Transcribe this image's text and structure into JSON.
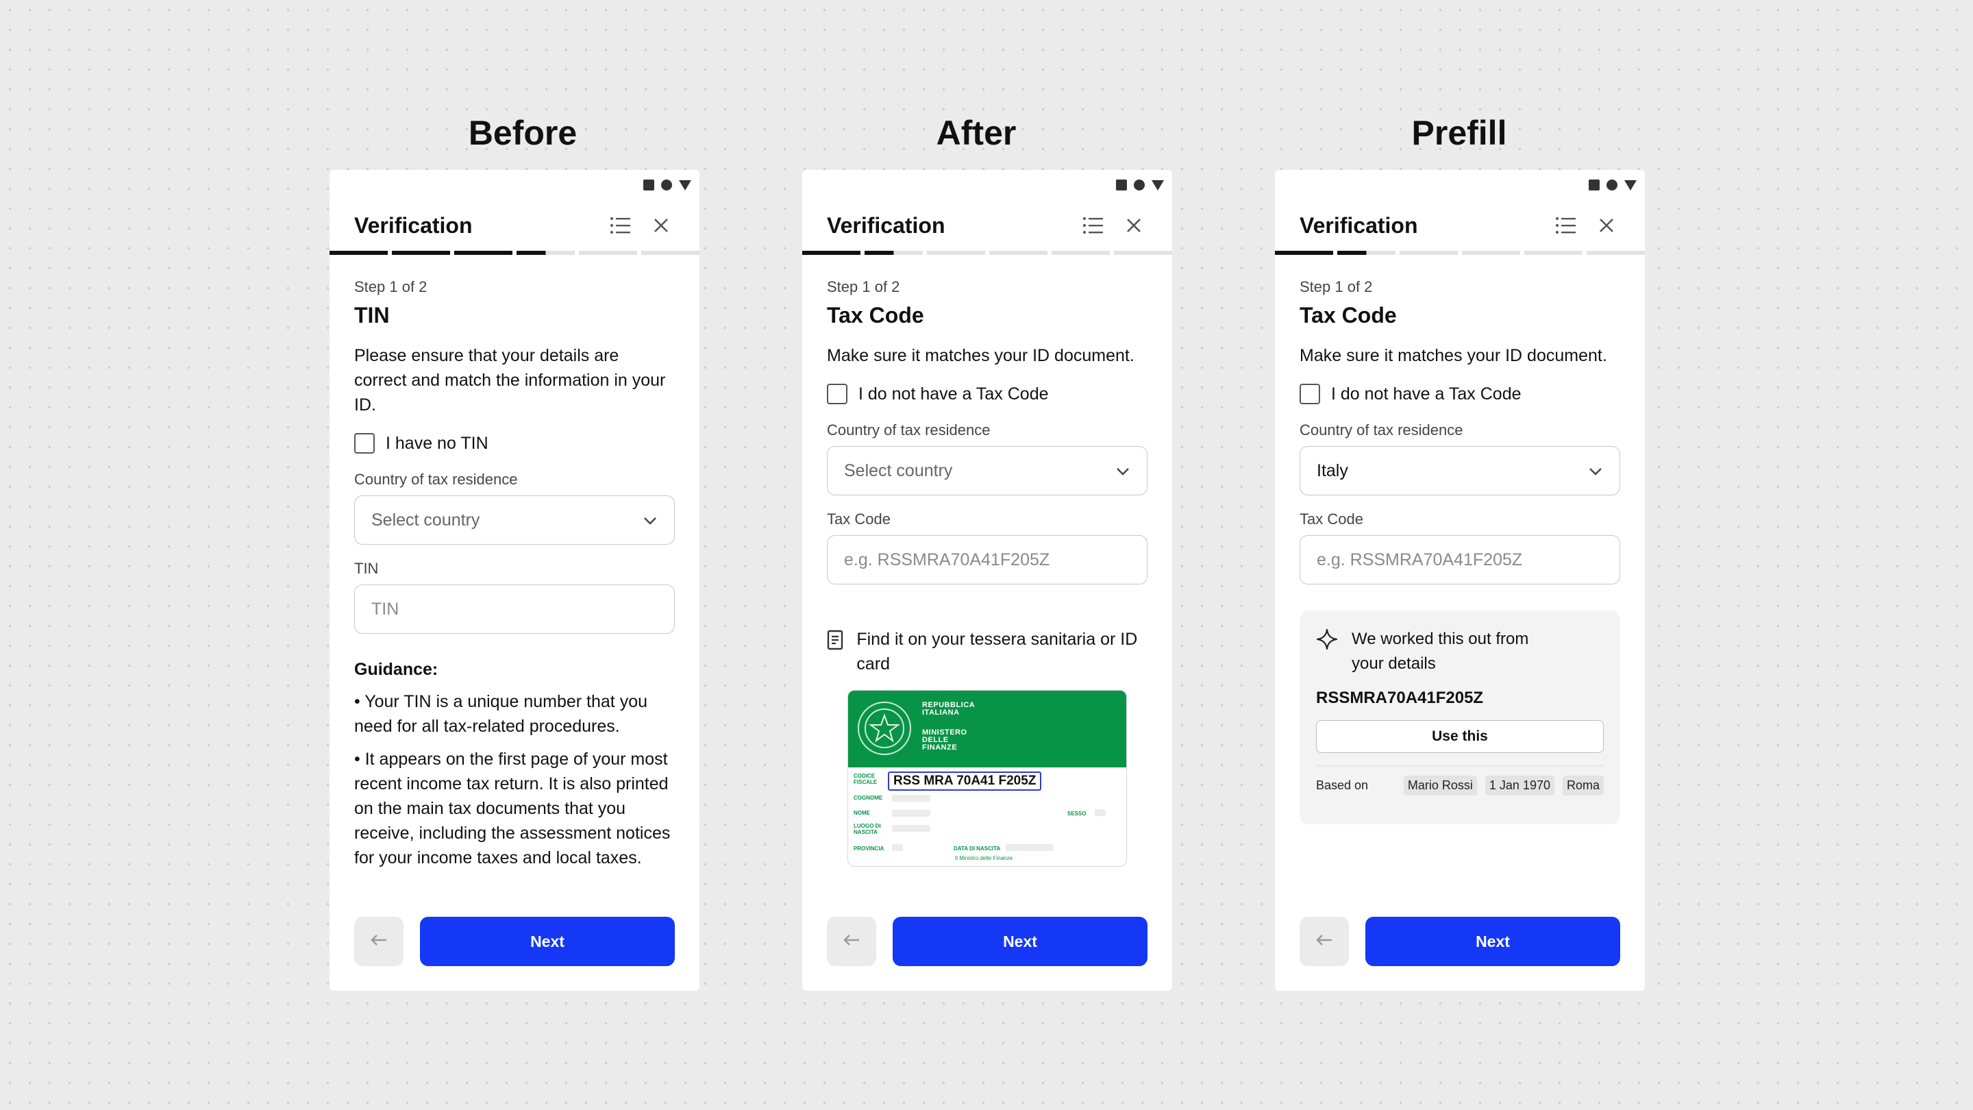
{
  "columns": [
    {
      "heading": "Before",
      "app_title": "Verification",
      "progress": {
        "total": 6,
        "complete": 3.5
      },
      "step": "Step 1 of 2",
      "title": "TIN",
      "description": "Please ensure that your details are correct and match the information in your ID.",
      "checkbox_label": "I have no TIN",
      "country_label": "Country of tax residence",
      "country_value": "Select country",
      "field_label": "TIN",
      "field_placeholder": "TIN",
      "guidance_title": "Guidance:",
      "guidance_items": [
        "• Your TIN is a unique number that you need for all tax-related procedures.",
        "• It appears on the first page of your most recent income tax return. It is also printed on the main tax documents that you receive, including the assessment notices for your income taxes and local taxes."
      ],
      "next_label": "Next"
    },
    {
      "heading": "After",
      "app_title": "Verification",
      "progress": {
        "total": 6,
        "complete": 1.5
      },
      "step": "Step 1 of 2",
      "title": "Tax Code",
      "description": "Make sure it matches your ID document.",
      "checkbox_label": "I do not have a Tax Code",
      "country_label": "Country of tax residence",
      "country_value": "Select country",
      "field_label": "Tax Code",
      "field_placeholder": "e.g. RSSMRA70A41F205Z",
      "hint_text": "Find it on your tessera sanitaria or ID card",
      "card": {
        "header_line1": "REPUBBLICA",
        "header_line2": "ITALIANA",
        "header_line3": "MINISTERO",
        "header_line4": "DELLE",
        "header_line5": "FINANZE",
        "code_label_1": "CODICE",
        "code_label_2": "FISCALE",
        "code_value": "RSS MRA 70A41 F205Z",
        "cognome": "COGNOME",
        "nome": "NOME",
        "sesso": "SESSO",
        "luogo_1": "LUOGO DI",
        "luogo_2": "NASCITA",
        "provincia": "PROVINCIA",
        "data_nascita": "DATA DI NASCITA",
        "footer": "Il Ministro delle Finanze"
      },
      "next_label": "Next"
    },
    {
      "heading": "Prefill",
      "app_title": "Verification",
      "progress": {
        "total": 6,
        "complete": 1.5
      },
      "step": "Step 1 of 2",
      "title": "Tax Code",
      "description": "Make sure it matches your ID document.",
      "checkbox_label": "I do not have a Tax Code",
      "country_label": "Country of tax residence",
      "country_value": "Italy",
      "field_label": "Tax Code",
      "field_placeholder": "e.g. RSSMRA70A41F205Z",
      "prefill": {
        "message": "We worked this out from your details",
        "code": "RSSMRA70A41F205Z",
        "use_label": "Use this",
        "based_on_label": "Based on",
        "chips": [
          "Mario Rossi",
          "1 Jan 1970",
          "Roma"
        ]
      },
      "next_label": "Next"
    }
  ],
  "colors": {
    "accent": "#1438f5",
    "card_green": "#089447",
    "background": "#ebebeb"
  },
  "icons": [
    "list-icon",
    "close-icon",
    "chevron-down-icon",
    "arrow-left-icon",
    "document-icon",
    "sparkle-icon"
  ]
}
